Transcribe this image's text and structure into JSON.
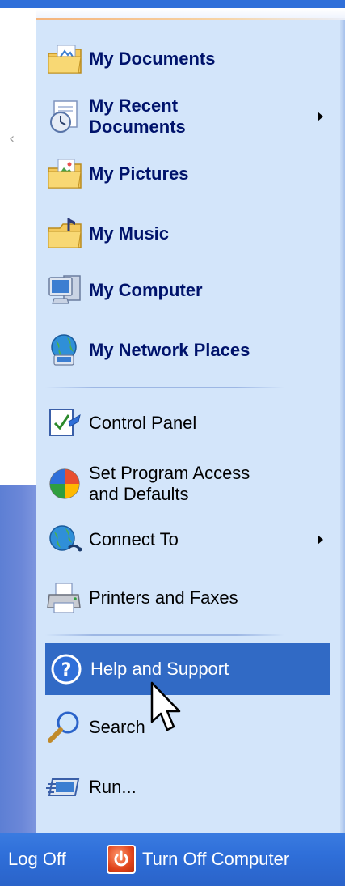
{
  "menu": {
    "places": [
      {
        "label": "My Documents",
        "icon": "my-documents-icon",
        "has_submenu": false
      },
      {
        "label": "My Recent\nDocuments",
        "icon": "recent-documents-icon",
        "has_submenu": true
      },
      {
        "label": "My Pictures",
        "icon": "my-pictures-icon",
        "has_submenu": false
      },
      {
        "label": "My Music",
        "icon": "my-music-icon",
        "has_submenu": false
      },
      {
        "label": "My Computer",
        "icon": "my-computer-icon",
        "has_submenu": false
      },
      {
        "label": "My Network Places",
        "icon": "network-places-icon",
        "has_submenu": false
      }
    ],
    "system": [
      {
        "label": "Control Panel",
        "icon": "control-panel-icon",
        "has_submenu": false
      },
      {
        "label": "Set Program Access\nand Defaults",
        "icon": "program-access-icon",
        "has_submenu": false
      },
      {
        "label": "Connect To",
        "icon": "connect-to-icon",
        "has_submenu": true
      },
      {
        "label": "Printers and Faxes",
        "icon": "printer-icon",
        "has_submenu": false
      }
    ],
    "help": [
      {
        "label": "Help and Support",
        "icon": "help-icon",
        "highlighted": true
      },
      {
        "label": "Search",
        "icon": "search-icon",
        "highlighted": false
      },
      {
        "label": "Run...",
        "icon": "run-icon",
        "highlighted": false
      }
    ]
  },
  "bottom": {
    "log_off": "Log Off",
    "turn_off": "Turn Off Computer"
  },
  "colors": {
    "panel": "#d3e5fa",
    "highlight": "#316ac5",
    "bar": "#2f6fd9",
    "bold_text": "#00136b"
  }
}
